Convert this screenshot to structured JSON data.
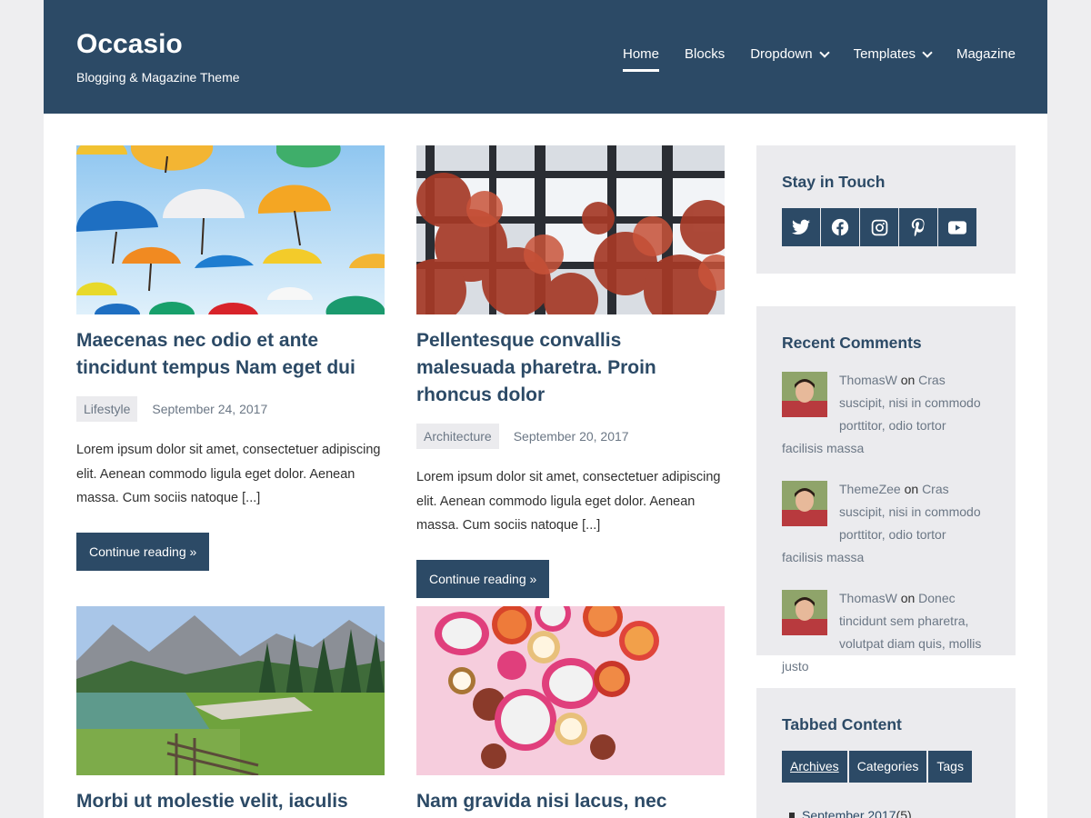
{
  "site": {
    "title": "Occasio",
    "description": "Blogging & Magazine Theme"
  },
  "nav": {
    "home": "Home",
    "blocks": "Blocks",
    "dropdown": "Dropdown",
    "templates": "Templates",
    "magazine": "Magazine"
  },
  "posts": [
    {
      "title": "Maecenas nec odio et ante tincidunt tempus Nam eget dui",
      "category": "Lifestyle",
      "date": "September 24, 2017",
      "excerpt": "Lorem ipsum dolor sit amet, consectetuer adipiscing elit. Aenean commodo ligula eget dolor. Aenean massa. Cum sociis natoque [...]",
      "button": "Continue reading »"
    },
    {
      "title": "Pellentesque convallis malesuada pharetra. Proin rhoncus dolor",
      "category": "Architecture",
      "date": "September 20, 2017",
      "excerpt": "Lorem ipsum dolor sit amet, consectetuer adipiscing elit. Aenean commodo ligula eget dolor. Aenean massa. Cum sociis natoque [...]",
      "button": "Continue reading »"
    },
    {
      "title": "Morbi ut molestie velit, iaculis"
    },
    {
      "title": "Nam gravida nisi lacus, nec"
    }
  ],
  "sidebar": {
    "stay_in_touch": {
      "title": "Stay in Touch",
      "icons": [
        "twitter-icon",
        "facebook-icon",
        "instagram-icon",
        "pinterest-icon",
        "youtube-icon"
      ]
    },
    "recent_comments": {
      "title": "Recent Comments",
      "on_word": "on",
      "items": [
        {
          "author": "ThomasW",
          "link": "Cras suscipit, nisi in commodo porttitor, odio tortor facilisis massa"
        },
        {
          "author": "ThemeZee",
          "link": "Cras suscipit, nisi in commodo porttitor, odio tortor facilisis massa"
        },
        {
          "author": "ThomasW",
          "link": "Donec tincidunt sem pharetra, volutpat diam quis, mollis justo"
        }
      ]
    },
    "tabbed": {
      "title": "Tabbed Content",
      "tabs": [
        "Archives",
        "Categories",
        "Tags"
      ],
      "archive_item": "September 2017",
      "archive_count": "(5)"
    }
  },
  "colors": {
    "header": "#2c4a66",
    "accent": "#2c4a66",
    "widget_bg": "#ebebee"
  }
}
